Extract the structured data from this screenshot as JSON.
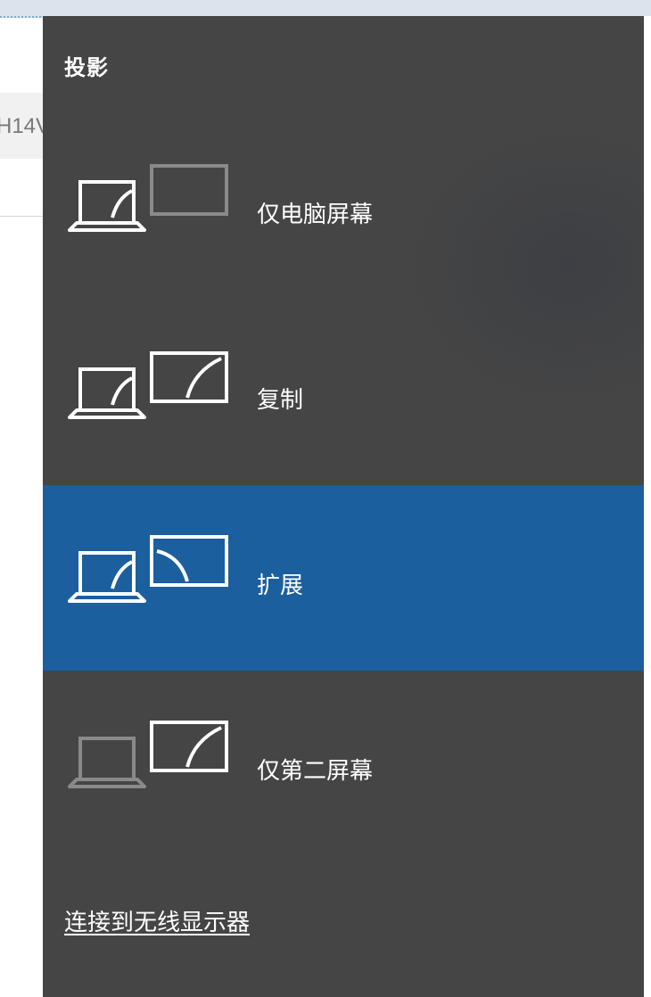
{
  "background": {
    "field_text": "H14V"
  },
  "panel": {
    "title": "投影",
    "options": [
      {
        "label": "仅电脑屏幕",
        "icon": "pc-screen-only-icon",
        "selected": false
      },
      {
        "label": "复制",
        "icon": "duplicate-icon",
        "selected": false
      },
      {
        "label": "扩展",
        "icon": "extend-icon",
        "selected": true
      },
      {
        "label": "仅第二屏幕",
        "icon": "second-screen-only-icon",
        "selected": false
      }
    ],
    "connect_link": "连接到无线显示器"
  },
  "colors": {
    "panel_bg": "#454545",
    "selected_bg": "#1b5f9e",
    "text": "#ffffff",
    "dimmed_icon": "#8a8a8a"
  }
}
